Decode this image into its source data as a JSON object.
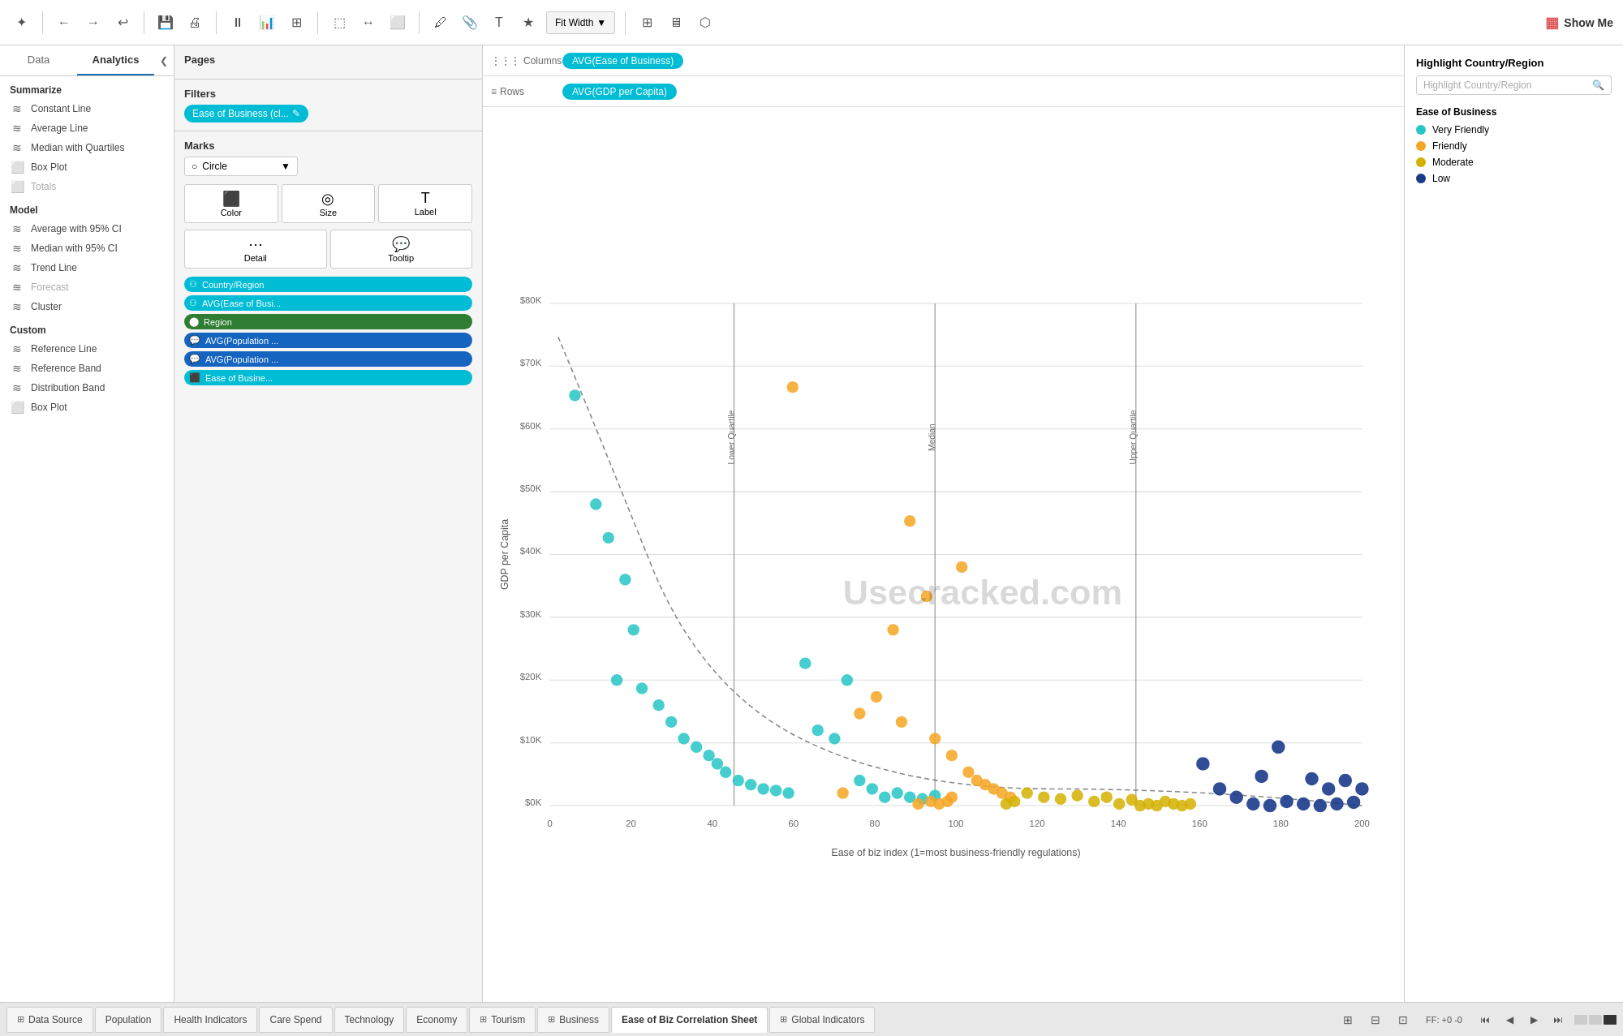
{
  "toolbar": {
    "fit_width_label": "Fit Width",
    "show_me_label": "Show Me"
  },
  "left_panel": {
    "tab_data": "Data",
    "tab_analytics": "Analytics",
    "summarize": {
      "header": "Summarize",
      "items": [
        {
          "label": "Constant Line",
          "icon": "≡"
        },
        {
          "label": "Average Line",
          "icon": "≡"
        },
        {
          "label": "Median with Quartiles",
          "icon": "≡"
        },
        {
          "label": "Box Plot",
          "icon": "⬜"
        },
        {
          "label": "Totals",
          "icon": "⬜"
        }
      ]
    },
    "model": {
      "header": "Model",
      "items": [
        {
          "label": "Average with 95% CI",
          "icon": "≡"
        },
        {
          "label": "Median with 95% CI",
          "icon": "≡"
        },
        {
          "label": "Trend Line",
          "icon": "≡"
        },
        {
          "label": "Forecast",
          "icon": "≡",
          "disabled": true
        },
        {
          "label": "Cluster",
          "icon": "≡"
        }
      ]
    },
    "custom": {
      "header": "Custom",
      "items": [
        {
          "label": "Reference Line",
          "icon": "≡"
        },
        {
          "label": "Reference Band",
          "icon": "≡"
        },
        {
          "label": "Distribution Band",
          "icon": "≡"
        },
        {
          "label": "Box Plot",
          "icon": "⬜"
        }
      ]
    }
  },
  "middle_panel": {
    "pages_label": "Pages",
    "filters_label": "Filters",
    "filter_pill": "Ease of Business (cl...",
    "marks_label": "Marks",
    "marks_type": "Circle",
    "marks_buttons": [
      "Color",
      "Size",
      "Label",
      "Detail",
      "Tooltip"
    ],
    "mark_pills": [
      {
        "label": "Country/Region",
        "type": "teal"
      },
      {
        "label": "AVG(Ease of Busi...",
        "type": "teal"
      },
      {
        "label": "Region",
        "type": "green"
      },
      {
        "label": "AVG(Population ...",
        "type": "blue-dark"
      },
      {
        "label": "AVG(Population ...",
        "type": "blue-dark"
      },
      {
        "label": "Ease of Busine...",
        "type": "teal"
      }
    ]
  },
  "chart": {
    "columns_label": "Columns",
    "rows_label": "Rows",
    "columns_pill": "AVG(Ease of Business)",
    "rows_pill": "AVG(GDP per Capita)",
    "x_axis_label": "Ease of biz index (1=most business-friendly regulations)",
    "y_axis_label": "GDP per Capita",
    "x_ticks": [
      "0",
      "20",
      "40",
      "60",
      "80",
      "100",
      "120",
      "140",
      "160",
      "180",
      "200"
    ],
    "y_ticks": [
      "$0K",
      "$10K",
      "$20K",
      "$30K",
      "$40K",
      "$50K",
      "$60K",
      "$70K",
      "$80K"
    ],
    "ref_lines": [
      {
        "label": "Lower Quartile",
        "x_pct": 22
      },
      {
        "label": "Median",
        "x_pct": 48
      },
      {
        "label": "Upper Quartile",
        "x_pct": 74
      }
    ],
    "watermark": "Usecracked.com"
  },
  "legend": {
    "highlight_title": "Highlight Country/Region",
    "highlight_placeholder": "Highlight Country/Region",
    "ease_title": "Ease of Business",
    "items": [
      {
        "label": "Very Friendly",
        "color": "#26c6c6"
      },
      {
        "label": "Friendly",
        "color": "#f5a623"
      },
      {
        "label": "Moderate",
        "color": "#d4b000"
      },
      {
        "label": "Low",
        "color": "#1a3a8a"
      }
    ]
  },
  "bottom_tabs": {
    "tabs": [
      {
        "label": "Data Source",
        "icon": "⊞",
        "active": false
      },
      {
        "label": "Population",
        "icon": "",
        "active": false
      },
      {
        "label": "Health Indicators",
        "icon": "",
        "active": false
      },
      {
        "label": "Care Spend",
        "icon": "",
        "active": false
      },
      {
        "label": "Technology",
        "icon": "",
        "active": false
      },
      {
        "label": "Economy",
        "icon": "",
        "active": false
      },
      {
        "label": "Tourism",
        "icon": "⊞",
        "active": false
      },
      {
        "label": "Business",
        "icon": "⊞",
        "active": false
      },
      {
        "label": "Ease of Biz Correlation Sheet",
        "icon": "",
        "active": true
      },
      {
        "label": "Global Indicators",
        "icon": "⊞",
        "active": false
      }
    ]
  },
  "status": {
    "ff_label": "FF: +0 -0"
  }
}
